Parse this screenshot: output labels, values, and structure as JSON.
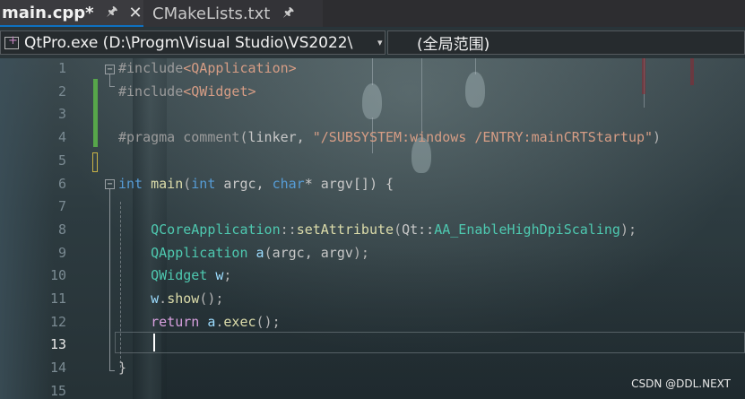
{
  "tabs": [
    {
      "title": "main.cpp*",
      "pin": "✉",
      "close": "✕"
    },
    {
      "title": "CMakeLists.txt",
      "pin": "✉"
    }
  ],
  "nav": {
    "project": "QtPro.exe (D:\\Progm\\Visual Studio\\VS2022\\",
    "scope": "(全局范围)",
    "chevron": "▾"
  },
  "editor": {
    "line_numbers": [
      "1",
      "2",
      "3",
      "4",
      "5",
      "6",
      "7",
      "8",
      "9",
      "10",
      "11",
      "12",
      "13",
      "14",
      "15"
    ],
    "current_line": "13",
    "lines": [
      {
        "n": "1",
        "parts": [
          [
            "dir",
            "#include"
          ],
          [
            "str",
            "<QApplication>"
          ]
        ]
      },
      {
        "n": "2",
        "parts": [
          [
            "dir",
            "#include"
          ],
          [
            "str",
            "<QWidget>"
          ]
        ]
      },
      {
        "n": "3",
        "parts": []
      },
      {
        "n": "4",
        "parts": [
          [
            "dir",
            "#pragma comment"
          ],
          [
            "pun",
            "("
          ],
          [
            "txt",
            "linker, "
          ],
          [
            "str",
            "\"/SUBSYSTEM:windows /ENTRY:mainCRTStartup\""
          ],
          [
            "pun",
            ")"
          ]
        ]
      },
      {
        "n": "5",
        "parts": []
      },
      {
        "n": "6",
        "parts": [
          [
            "kw",
            "int"
          ],
          [
            "txt",
            " "
          ],
          [
            "fn",
            "main"
          ],
          [
            "pun",
            "("
          ],
          [
            "kw",
            "int"
          ],
          [
            "txt",
            " argc, "
          ],
          [
            "kw",
            "char"
          ],
          [
            "txt",
            "* argv[]) {"
          ]
        ]
      },
      {
        "n": "7",
        "parts": []
      },
      {
        "n": "8",
        "parts": [
          [
            "txt",
            "    "
          ],
          [
            "type",
            "QCoreApplication"
          ],
          [
            "pun",
            "::"
          ],
          [
            "fn",
            "setAttribute"
          ],
          [
            "pun",
            "("
          ],
          [
            "txt",
            "Qt::"
          ],
          [
            "type",
            "AA_EnableHighDpiScaling"
          ],
          [
            "pun",
            ");"
          ]
        ]
      },
      {
        "n": "9",
        "parts": [
          [
            "txt",
            "    "
          ],
          [
            "type",
            "QApplication"
          ],
          [
            "txt",
            " "
          ],
          [
            "var",
            "a"
          ],
          [
            "pun",
            "("
          ],
          [
            "txt",
            "argc, argv"
          ],
          [
            "pun",
            ");"
          ]
        ]
      },
      {
        "n": "10",
        "parts": [
          [
            "txt",
            "    "
          ],
          [
            "type",
            "QWidget"
          ],
          [
            "txt",
            " "
          ],
          [
            "var",
            "w"
          ],
          [
            "pun",
            ";"
          ]
        ]
      },
      {
        "n": "11",
        "parts": [
          [
            "txt",
            "    "
          ],
          [
            "var",
            "w"
          ],
          [
            "pun",
            "."
          ],
          [
            "fn",
            "show"
          ],
          [
            "pun",
            "();"
          ]
        ]
      },
      {
        "n": "12",
        "parts": [
          [
            "txt",
            "    "
          ],
          [
            "ctl",
            "return"
          ],
          [
            "txt",
            " "
          ],
          [
            "var",
            "a"
          ],
          [
            "pun",
            "."
          ],
          [
            "fn",
            "exec"
          ],
          [
            "pun",
            "();"
          ]
        ]
      },
      {
        "n": "13",
        "parts": []
      },
      {
        "n": "14",
        "parts": [
          [
            "txt",
            "}"
          ]
        ]
      },
      {
        "n": "15",
        "parts": []
      }
    ]
  },
  "watermark": "CSDN @DDL.NEXT",
  "colors": {
    "keyword": "#569cd6",
    "function": "#dcdcaa",
    "type": "#4ec9b0",
    "string": "#d69d85",
    "directive": "#9b9b9b",
    "change_saved": "#57a64a",
    "change_unsaved": "#c9b347"
  }
}
